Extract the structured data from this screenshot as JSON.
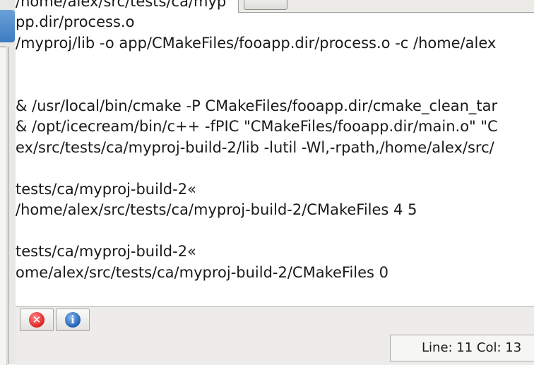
{
  "output": {
    "lines": [
      "/home/alex/src/tests/ca/myp",
      "pp.dir/process.o",
      "/myproj/lib -o app/CMakeFiles/fooapp.dir/process.o -c /home/alex",
      "",
      "",
      "& /usr/local/bin/cmake -P CMakeFiles/fooapp.dir/cmake_clean_tar",
      "& /opt/icecream/bin/c++ -fPIC \"CMakeFiles/fooapp.dir/main.o\" \"C",
      "ex/src/tests/ca/myproj-build-2/lib -lutil -Wl,-rpath,/home/alex/src/",
      "",
      "tests/ca/myproj-build-2«",
      "/home/alex/src/tests/ca/myproj-build-2/CMakeFiles 4 5",
      "",
      "tests/ca/myproj-build-2«",
      "ome/alex/src/tests/ca/myproj-build-2/CMakeFiles 0"
    ]
  },
  "toolbar": {
    "error_icon": "error-circle-icon",
    "info_icon": "info-circle-icon",
    "info_glyph": "i",
    "error_glyph": "✕"
  },
  "status": {
    "position": "Line: 11 Col: 13"
  },
  "colors": {
    "error": "#dd2222",
    "info": "#1f5fb3"
  }
}
